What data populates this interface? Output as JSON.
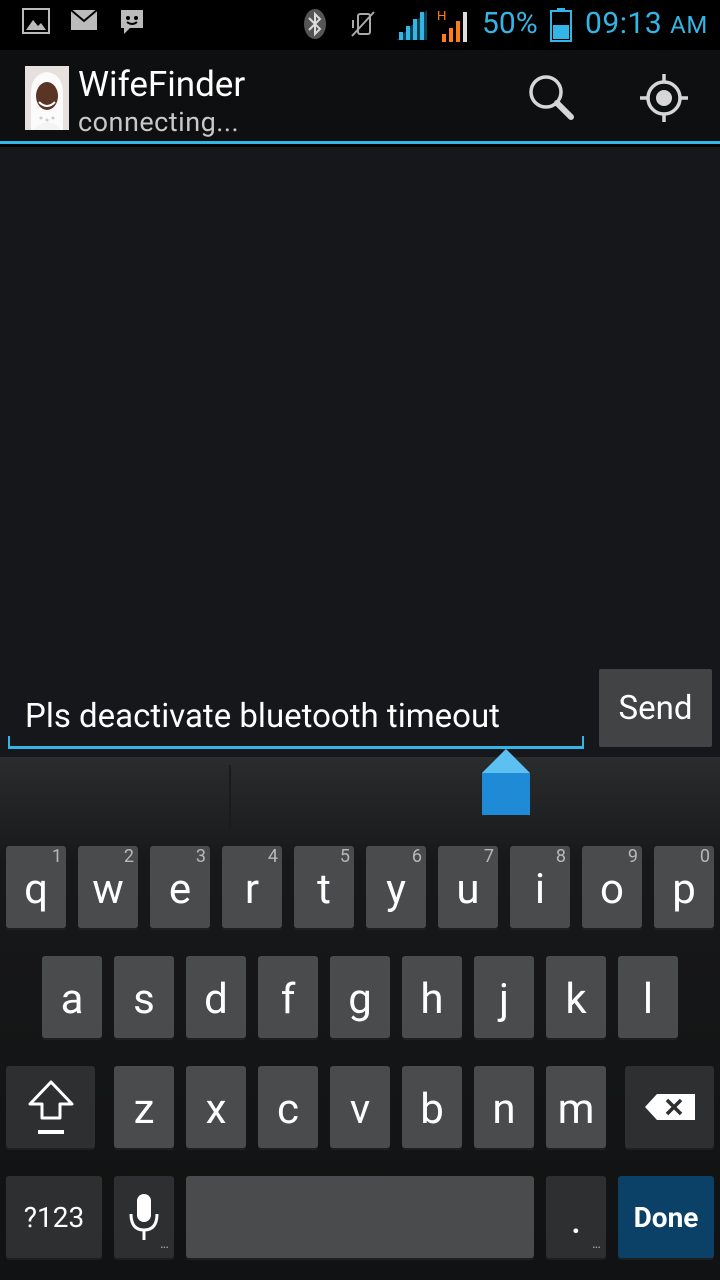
{
  "status_bar": {
    "icons": [
      "picture-icon",
      "mail-icon",
      "chat-icon",
      "bluetooth-icon",
      "vibrate-off-icon",
      "signal-icon",
      "hspa-signal-icon",
      "battery-icon"
    ],
    "network_type": "H",
    "battery_percent": "50%",
    "time": "09:13",
    "am_pm": "AM"
  },
  "action_bar": {
    "title": "WifeFinder",
    "subtitle": "connecting...",
    "actions": [
      "search-icon",
      "locate-icon"
    ]
  },
  "composer": {
    "message_value": "Pls deactivate bluetooth timeout",
    "send_label": "Send"
  },
  "keyboard": {
    "row1": [
      {
        "letter": "q",
        "hint": "1"
      },
      {
        "letter": "w",
        "hint": "2"
      },
      {
        "letter": "e",
        "hint": "3"
      },
      {
        "letter": "r",
        "hint": "4"
      },
      {
        "letter": "t",
        "hint": "5"
      },
      {
        "letter": "y",
        "hint": "6"
      },
      {
        "letter": "u",
        "hint": "7"
      },
      {
        "letter": "i",
        "hint": "8"
      },
      {
        "letter": "o",
        "hint": "9"
      },
      {
        "letter": "p",
        "hint": "0"
      }
    ],
    "row2": [
      "a",
      "s",
      "d",
      "f",
      "g",
      "h",
      "j",
      "k",
      "l"
    ],
    "row3": [
      "z",
      "x",
      "c",
      "v",
      "b",
      "n",
      "m"
    ],
    "symbols_label": "?123",
    "period_label": ".",
    "done_label": "Done"
  },
  "colors": {
    "accent": "#33b5e5",
    "key": "#4a4b4d",
    "done_key": "#0b4067"
  }
}
